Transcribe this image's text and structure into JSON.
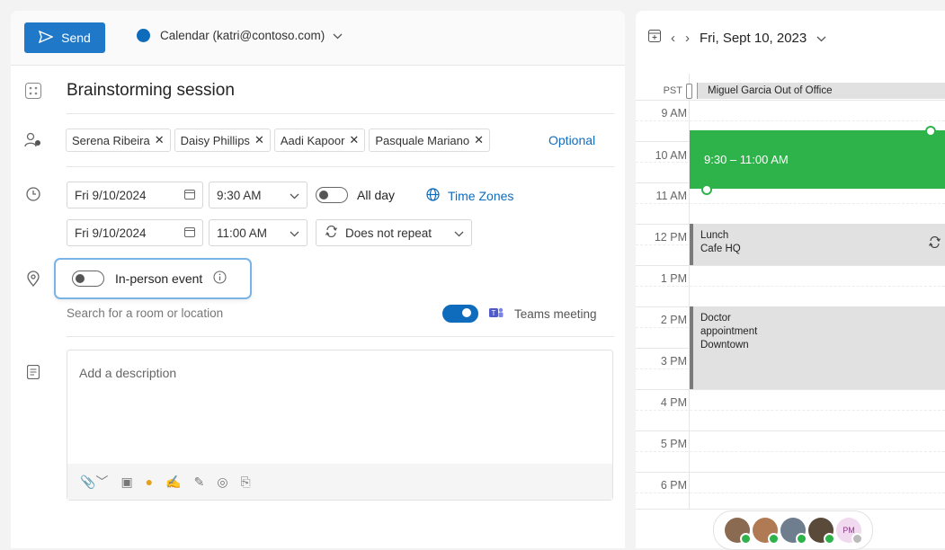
{
  "toolbar": {
    "send_label": "Send",
    "calendar_label": "Calendar (katri@contoso.com)"
  },
  "event": {
    "title": "Brainstorming session"
  },
  "attendees": {
    "items": [
      "Serena Ribeira",
      "Daisy Phillips",
      "Aadi Kapoor",
      "Pasquale Mariano"
    ],
    "optional_label": "Optional"
  },
  "schedule": {
    "start_date": "Fri 9/10/2024",
    "start_time": "9:30 AM",
    "end_date": "Fri 9/10/2024",
    "end_time": "11:00 AM",
    "all_day_label": "All day",
    "all_day": false,
    "time_zones_label": "Time Zones",
    "repeat_label": "Does not repeat"
  },
  "location": {
    "in_person_label": "In-person event",
    "in_person": false,
    "search_placeholder": "Search for a room or location",
    "teams_label": "Teams meeting",
    "teams_enabled": true
  },
  "description": {
    "placeholder": "Add a description"
  },
  "calendar": {
    "date_label": "Fri, Sept 10, 2023",
    "timezone_label": "PST",
    "all_day_event": "Miguel Garcia Out of Office",
    "hours": [
      "9 AM",
      "10 AM",
      "11 AM",
      "12 PM",
      "1 PM",
      "2 PM",
      "3 PM",
      "4 PM",
      "5 PM",
      "6 PM"
    ],
    "events": {
      "current": {
        "time_label": "9:30 – 11:00 AM",
        "color": "#2db34a"
      },
      "lunch": {
        "title": "Lunch",
        "location": "Cafe HQ"
      },
      "doctor": {
        "title": "Doctor appointment",
        "title_line1": "Doctor",
        "title_line2": "appointment",
        "location": "Downtown"
      }
    },
    "avatar_initials": "PM"
  },
  "colors": {
    "accent": "#0f6cbd",
    "send": "#1f78c8",
    "event_green": "#2db34a"
  }
}
